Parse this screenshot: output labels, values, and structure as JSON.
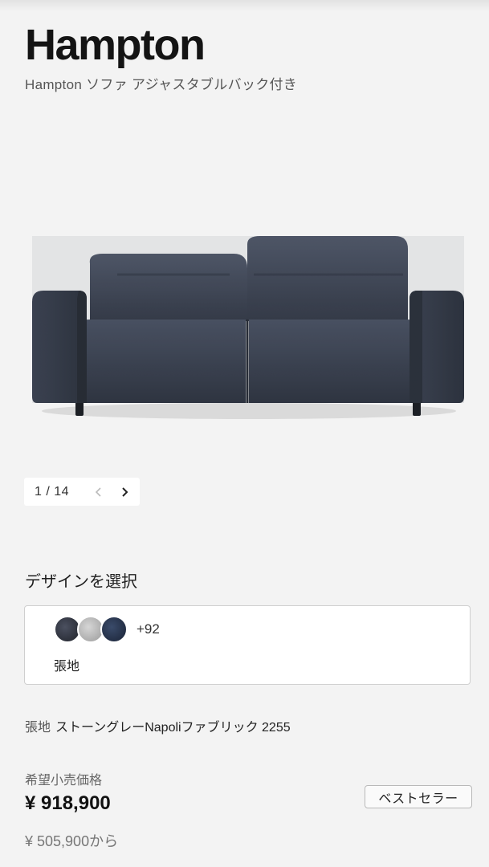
{
  "product": {
    "name": "Hampton",
    "subtitle": "Hampton ソファ アジャスタブルバック付き",
    "image_name": "navy-sofa-image"
  },
  "gallery": {
    "current": "1",
    "total": "14",
    "counter_text": "1 / 14",
    "prev_icon": "chevron-left-icon",
    "next_icon": "chevron-right-icon"
  },
  "design": {
    "heading": "デザインを選択",
    "swatches": [
      {
        "name": "dark-grey-swatch",
        "color": "#2d3138"
      },
      {
        "name": "light-grey-swatch",
        "color": "#b9b9b9"
      },
      {
        "name": "navy-swatch",
        "color": "#25324a"
      }
    ],
    "more_count": "+92",
    "label": "張地"
  },
  "selection": {
    "label": "張地",
    "value": "ストーングレーNapoliファブリック 2255"
  },
  "pricing": {
    "label": "希望小売価格",
    "price": "¥ 918,900",
    "from_price": "¥ 505,900から",
    "badge": "ベストセラー"
  },
  "colors": {
    "background": "#f3f3f3",
    "sofa": "#3a4150"
  }
}
